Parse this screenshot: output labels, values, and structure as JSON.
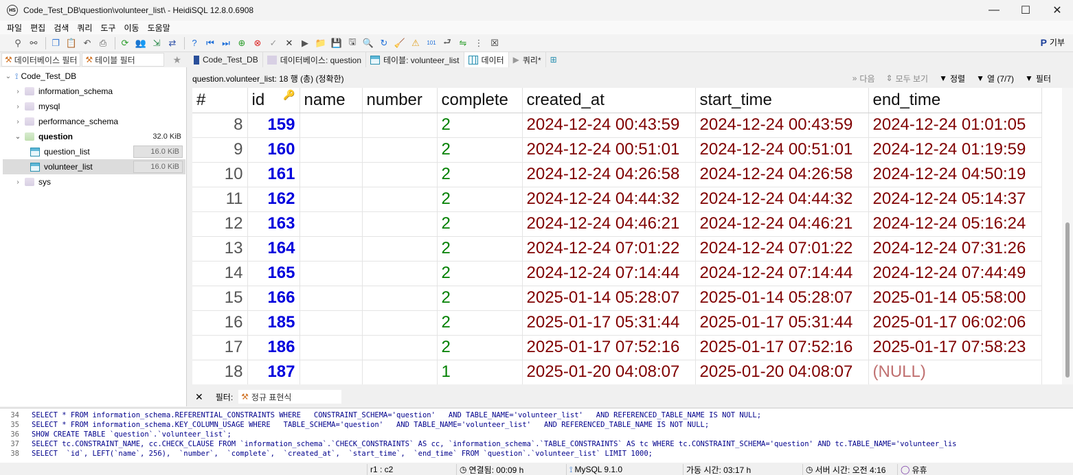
{
  "window": {
    "title": "Code_Test_DB\\question\\volunteer_list\\ - HeidiSQL 12.8.0.6908",
    "minimize": "—",
    "maximize": "☐",
    "close": "✕"
  },
  "menu": [
    "파일",
    "편집",
    "검색",
    "쿼리",
    "도구",
    "이동",
    "도움말"
  ],
  "toolbar": {
    "donate_label": "기부"
  },
  "left_panel": {
    "db_filter_label": "데이터베이스 필터",
    "table_filter_label": "테이블 필터",
    "tree": {
      "root": "Code_Test_DB",
      "items": [
        {
          "name": "information_schema",
          "size": ""
        },
        {
          "name": "mysql",
          "size": ""
        },
        {
          "name": "performance_schema",
          "size": ""
        },
        {
          "name": "question",
          "size": "32.0 KiB"
        },
        {
          "name": "question_list",
          "size": "16.0 KiB"
        },
        {
          "name": "volunteer_list",
          "size": "16.0 KiB"
        },
        {
          "name": "sys",
          "size": ""
        }
      ]
    }
  },
  "tabs": [
    {
      "label": "Code_Test_DB"
    },
    {
      "label": "데이터베이스: question"
    },
    {
      "label": "테이블: volunteer_list"
    },
    {
      "label": "데이터"
    },
    {
      "label": "쿼리*"
    }
  ],
  "infobar": {
    "text": "question.volunteer_list: 18 행 (총) (정확한)",
    "next": "다음",
    "show_all": "모두 보기",
    "sort": "정렬",
    "columns": "열 (7/7)",
    "filter": "필터"
  },
  "grid": {
    "columns": [
      "#",
      "id",
      "name",
      "number",
      "complete",
      "created_at",
      "start_time",
      "end_time"
    ],
    "rows": [
      {
        "n": "8",
        "id": "159",
        "name": "",
        "number": "",
        "complete": "2",
        "created_at": "2024-12-24 00:43:59",
        "start_time": "2024-12-24 00:43:59",
        "end_time": "2024-12-24 01:01:05"
      },
      {
        "n": "9",
        "id": "160",
        "name": "",
        "number": "",
        "complete": "2",
        "created_at": "2024-12-24 00:51:01",
        "start_time": "2024-12-24 00:51:01",
        "end_time": "2024-12-24 01:19:59"
      },
      {
        "n": "10",
        "id": "161",
        "name": "",
        "number": "",
        "complete": "2",
        "created_at": "2024-12-24 04:26:58",
        "start_time": "2024-12-24 04:26:58",
        "end_time": "2024-12-24 04:50:19"
      },
      {
        "n": "11",
        "id": "162",
        "name": "",
        "number": "",
        "complete": "2",
        "created_at": "2024-12-24 04:44:32",
        "start_time": "2024-12-24 04:44:32",
        "end_time": "2024-12-24 05:14:37"
      },
      {
        "n": "12",
        "id": "163",
        "name": "",
        "number": "",
        "complete": "2",
        "created_at": "2024-12-24 04:46:21",
        "start_time": "2024-12-24 04:46:21",
        "end_time": "2024-12-24 05:16:24"
      },
      {
        "n": "13",
        "id": "164",
        "name": "",
        "number": "",
        "complete": "2",
        "created_at": "2024-12-24 07:01:22",
        "start_time": "2024-12-24 07:01:22",
        "end_time": "2024-12-24 07:31:26"
      },
      {
        "n": "14",
        "id": "165",
        "name": "",
        "number": "",
        "complete": "2",
        "created_at": "2024-12-24 07:14:44",
        "start_time": "2024-12-24 07:14:44",
        "end_time": "2024-12-24 07:44:49"
      },
      {
        "n": "15",
        "id": "166",
        "name": "",
        "number": "",
        "complete": "2",
        "created_at": "2025-01-14 05:28:07",
        "start_time": "2025-01-14 05:28:07",
        "end_time": "2025-01-14 05:58:00"
      },
      {
        "n": "16",
        "id": "185",
        "name": "",
        "number": "",
        "complete": "2",
        "created_at": "2025-01-17 05:31:44",
        "start_time": "2025-01-17 05:31:44",
        "end_time": "2025-01-17 06:02:06"
      },
      {
        "n": "17",
        "id": "186",
        "name": "",
        "number": "",
        "complete": "2",
        "created_at": "2025-01-17 07:52:16",
        "start_time": "2025-01-17 07:52:16",
        "end_time": "2025-01-17 07:58:23"
      },
      {
        "n": "18",
        "id": "187",
        "name": "",
        "number": "",
        "complete": "1",
        "created_at": "2025-01-20 04:08:07",
        "start_time": "2025-01-20 04:08:07",
        "end_time": "(NULL)"
      }
    ]
  },
  "filterbar": {
    "label": "필터:",
    "regex_label": "정규 표현식"
  },
  "query_log": [
    {
      "n": "34",
      "sql": "SELECT * FROM information_schema.REFERENTIAL_CONSTRAINTS WHERE   CONSTRAINT_SCHEMA='question'   AND TABLE_NAME='volunteer_list'   AND REFERENCED_TABLE_NAME IS NOT NULL;"
    },
    {
      "n": "35",
      "sql": "SELECT * FROM information_schema.KEY_COLUMN_USAGE WHERE   TABLE_SCHEMA='question'   AND TABLE_NAME='volunteer_list'   AND REFERENCED_TABLE_NAME IS NOT NULL;"
    },
    {
      "n": "36",
      "sql": "SHOW CREATE TABLE `question`.`volunteer_list`;"
    },
    {
      "n": "37",
      "sql": "SELECT tc.CONSTRAINT_NAME, cc.CHECK_CLAUSE FROM `information_schema`.`CHECK_CONSTRAINTS` AS cc, `information_schema`.`TABLE_CONSTRAINTS` AS tc WHERE tc.CONSTRAINT_SCHEMA='question' AND tc.TABLE_NAME='volunteer_lis"
    },
    {
      "n": "38",
      "sql": "SELECT  `id`, LEFT(`name`, 256),  `number`,  `complete`,  `created_at`,  `start_time`,  `end_time` FROM `question`.`volunteer_list` LIMIT 1000;"
    }
  ],
  "statusbar": {
    "cursor": "r1 : c2",
    "connected": "연결됨: 00:09 h",
    "server": "MySQL 9.1.0",
    "uptime": "가동 시간: 03:17 h",
    "server_time": "서버 시간: 오전 4:16",
    "idle": "유휴"
  },
  "colors": {
    "id": "#0000dd",
    "complete": "#008000",
    "datetime": "#800000",
    "null": "#c07070"
  }
}
